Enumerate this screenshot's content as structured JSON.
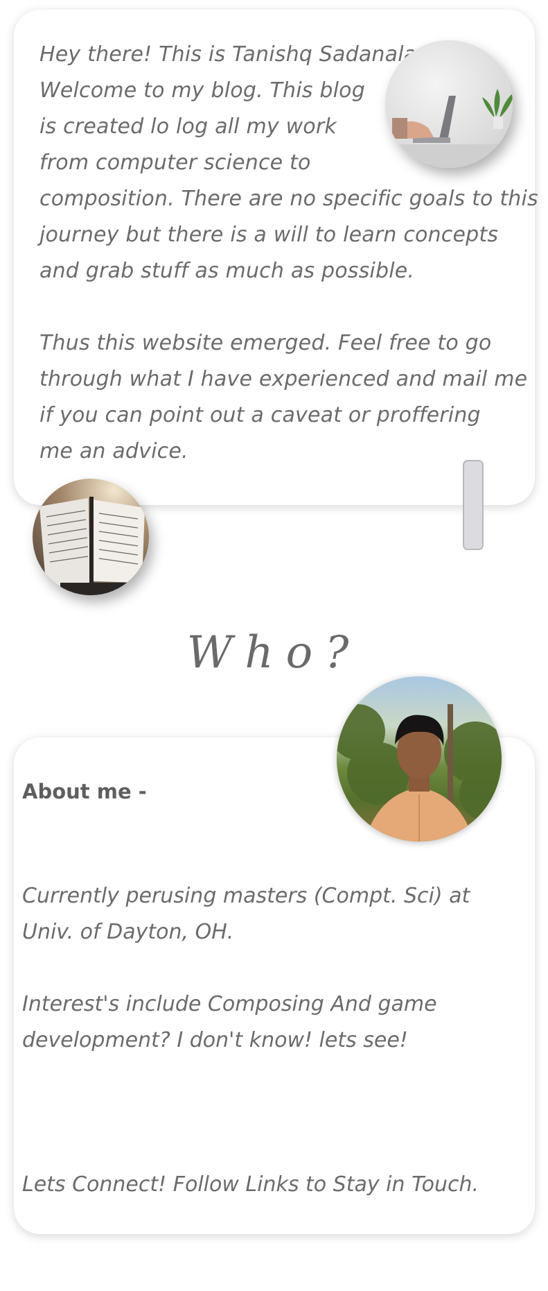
{
  "intro": {
    "lines": [
      "Hey there! This is Tanishq Sadanala.",
      "Welcome to my blog. This blog",
      "is created lo log all my work",
      "from computer science to",
      "composition. There are no specific goals to this",
      "journey but there is a will to learn concepts",
      "and grab stuff as much as possible.",
      "",
      "Thus this website emerged. Feel free to go",
      "through what I have experienced and mail me",
      " if you can point out a caveat or proffering",
      "me an advice."
    ]
  },
  "who": {
    "heading": "Who?"
  },
  "about": {
    "heading": "About me -",
    "para1": [
      "Currently perusing masters (Compt. Sci) at",
      "Univ. of Dayton, OH."
    ],
    "para2": [
      "Interest's include Composing And game",
      "development? I don't know! lets see!"
    ],
    "connect": "Lets Connect! Follow Links to Stay in Touch."
  }
}
